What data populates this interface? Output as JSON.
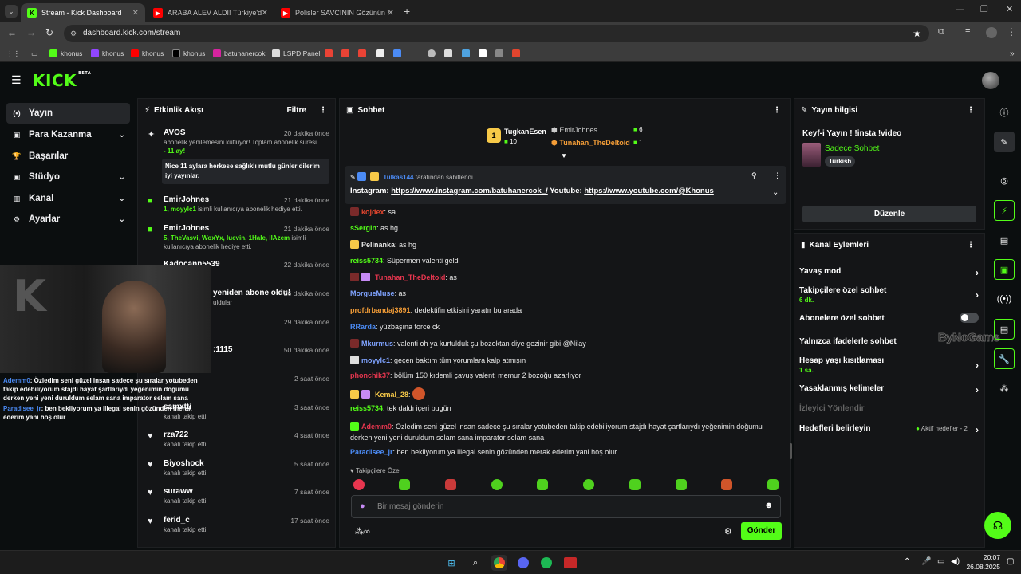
{
  "browser": {
    "tabs": [
      {
        "title": "Stream - Kick Dashboard",
        "active": true
      },
      {
        "title": "ARABA ALEV ALDI! Türkiye'de Y"
      },
      {
        "title": "Polisler SAVCININ Gözünün Yaş"
      }
    ],
    "url": "dashboard.kick.com/stream",
    "bookmarks": [
      "khonus",
      "khonus",
      "khonus",
      "khonus",
      "batuhanercok",
      "LSPD Panel"
    ]
  },
  "app": {
    "logo": "KICK",
    "logo_sup": "BETA"
  },
  "nav": [
    {
      "label": "Yayın",
      "icon": "(•)",
      "active": true
    },
    {
      "label": "Para Kazanma",
      "icon": "▣",
      "chevron": true
    },
    {
      "label": "Başarılar",
      "icon": "🏆"
    },
    {
      "label": "Stüdyo",
      "icon": "▣",
      "chevron": true
    },
    {
      "label": "Kanal",
      "icon": "▥",
      "chevron": true
    },
    {
      "label": "Ayarlar",
      "icon": "⚙",
      "chevron": true
    }
  ],
  "activity": {
    "title": "Etkinlik Akışı",
    "filter": "Filtre",
    "events": [
      {
        "name": "AVOS",
        "time": "20 dakika önce",
        "sub": "abonelik yenilemesini kutluyor! Toplam abonelik süresi",
        "sub2": "- 11 ay!",
        "quote": "Nice 11 aylara herkese sağlıklı mutlu günler dilerim iyi yayınlar."
      },
      {
        "name": "EmirJohnes",
        "time": "21 dakika önce",
        "highlight": "1, moyylc1",
        "sub": " isimli kullanıcıya abonelik hediye etti."
      },
      {
        "name": "EmirJohnes",
        "time": "21 dakika önce",
        "highlight": "5, TheVasvi, WoxYx, luevin, 1Hale, IlAzem",
        "sub": " isimli",
        "sub2": "kullanıcıya abonelik hediye etti."
      },
      {
        "name": "Kadocann5539",
        "time": "22 dakika önce"
      },
      {
        "name": "yeniden abone oldu!",
        "time": "26 dakika önce",
        "sub": "uldular"
      },
      {
        "name": "",
        "time": "29 dakika önce"
      },
      {
        "name": ":1115",
        "time": "50 dakika önce"
      },
      {
        "name": "",
        "time": "2 saat önce"
      },
      {
        "name": "samxtti",
        "time": "3 saat önce",
        "sub": "kanalı takip etti"
      },
      {
        "name": "rza722",
        "time": "4 saat önce",
        "sub": "kanalı takip etti"
      },
      {
        "name": "Biyoshock",
        "time": "5 saat önce",
        "sub": "kanalı takip etti"
      },
      {
        "name": "suraww",
        "time": "7 saat önce",
        "sub": "kanalı takip etti"
      },
      {
        "name": "ferid_c",
        "time": "17 saat önce",
        "sub": "kanalı takip etti"
      }
    ]
  },
  "overlay_chat": [
    {
      "user": "Ademm0",
      "text": ": Özledim seni güzel insan sadece şu sıralar yotubeden takip edebiliyorum stajdı hayat şartlarıydı yeğenimin doğumu derken yeni yeni duruldum selam sana imparator selam sana"
    },
    {
      "user": "Paradisee_jr",
      "text": ": ben bekliyorum ya illegal senin gözünden merak ederim yani hoş olur"
    }
  ],
  "chat": {
    "title": "Sohbet",
    "leaders": [
      {
        "rank": "1",
        "name": "TugkanEsen",
        "count": "10"
      },
      {
        "name": "EmirJohnes",
        "count": "6"
      },
      {
        "name": "Tunahan_TheDeltoid",
        "count": "1"
      }
    ],
    "pinned": {
      "by": "Tulkas144",
      "by_suffix": "tarafından sabitlendi",
      "text_prefix": "Instagram: ",
      "link1": "https://www.instagram.com/batuhanercok_/",
      "text_mid": " Youtube: ",
      "link2": "https://www.youtube.com/@Khonus"
    },
    "messages": [
      {
        "user": "kojdex",
        "color": "#e2452e",
        "text": ": sa"
      },
      {
        "user": "sSergin",
        "color": "#53fc18",
        "text": ": as hg"
      },
      {
        "user": "Pelinanka",
        "color": "#e6e6e6",
        "text": ": as hg"
      },
      {
        "user": "reiss5734",
        "color": "#53fc18",
        "text": ": Süpermen valenti geldi"
      },
      {
        "user": "Tunahan_TheDeltoid",
        "color": "#e8364f",
        "text": ": as"
      },
      {
        "user": "MorgueMuse",
        "color": "#7fa3ff",
        "text": ": as"
      },
      {
        "user": "profdrbandaj3891",
        "color": "#f49d37",
        "text": ": dedektifin etkisini yaratır bu arada"
      },
      {
        "user": "RRarda",
        "color": "#4b8bf5",
        "text": ": yüzbaşına force ck"
      },
      {
        "user": "Mkurmus",
        "color": "#7fa3ff",
        "text": ": valenti oh ya kurtulduk şu bozoktan diye gezinir gibi @Nilay"
      },
      {
        "user": "moyylc1",
        "color": "#7fa3ff",
        "text": ": geçen baktım tüm yorumlara kalp atmışın"
      },
      {
        "user": "phonchik37",
        "color": "#e8364f",
        "text": ": bölüm 150 kıdemli çavuş valenti memur 2 bozoğu azarlıyor"
      },
      {
        "user": "Kemal_28",
        "color": "#f7c948",
        "text": ":"
      },
      {
        "user": "reiss5734",
        "color": "#53fc18",
        "text": ": tek daldı içeri bugün"
      },
      {
        "user": "Ademm0",
        "color": "#e8364f",
        "text": ": Özledim seni güzel insan sadece şu sıralar yotubeden takip edebiliyorum stajdı hayat şartlarıydı yeğenimin doğumu",
        "text2": "derken yeni yeni duruldum selam sana imparator selam sana"
      },
      {
        "user": "Paradisee_jr",
        "color": "#4b8bf5",
        "text": ": ben bekliyorum ya illegal senin gözünden merak ederim yani hoş olur"
      }
    ],
    "followers_only": "Takipçilere Özel",
    "input_placeholder": "Bir mesaj gönderin",
    "send": "Gönder"
  },
  "stream_info": {
    "title": "Yayın bilgisi",
    "stream_title": "Keyf-i Yayın ! !insta !video",
    "category": "Sadece Sohbet",
    "tag": "Turkish",
    "edit": "Düzenle"
  },
  "channel_actions": {
    "title": "Kanal Eylemleri",
    "items": [
      {
        "label": "Yavaş mod"
      },
      {
        "label": "Takipçilere özel sohbet",
        "sub": "6 dk."
      },
      {
        "label": "Abonelere özel sohbet",
        "toggle": true
      },
      {
        "label": "Yalnızca ifadelerle sohbet"
      },
      {
        "label": "Hesap yaşı kısıtlaması",
        "sub": "1 sa."
      },
      {
        "label": "Yasaklanmış kelimeler"
      },
      {
        "label": "İzleyici Yönlendir",
        "disabled": true
      },
      {
        "label": "Hedefleri belirleyin",
        "extra": "Aktif hedefler - 2"
      }
    ]
  },
  "watermark": "ByNoGame",
  "taskbar": {
    "time": "20:07",
    "date": "26.08.2025"
  },
  "colors": {
    "accent": "#53fc18",
    "panel": "#141517",
    "bg": "#0b0e0f"
  }
}
